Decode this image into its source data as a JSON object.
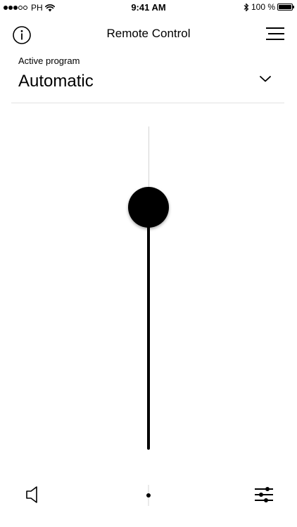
{
  "status_bar": {
    "carrier": "PH",
    "time": "9:41 AM",
    "battery_text": "100 %",
    "signal_bars_filled": 3,
    "signal_bars_total": 5,
    "icons": [
      "wifi-icon",
      "bluetooth-icon",
      "battery-icon"
    ]
  },
  "header": {
    "title": "Remote Control",
    "left_icon": "info-icon",
    "right_icon": "menu-icon"
  },
  "program": {
    "label": "Active program",
    "value": "Automatic",
    "icon": "chevron-down-icon"
  },
  "slider": {
    "value_fraction": 0.75
  },
  "bottom_bar": {
    "left_icon": "speaker-icon",
    "center_icon": "page-indicator-icon",
    "right_icon": "sliders-icon"
  }
}
